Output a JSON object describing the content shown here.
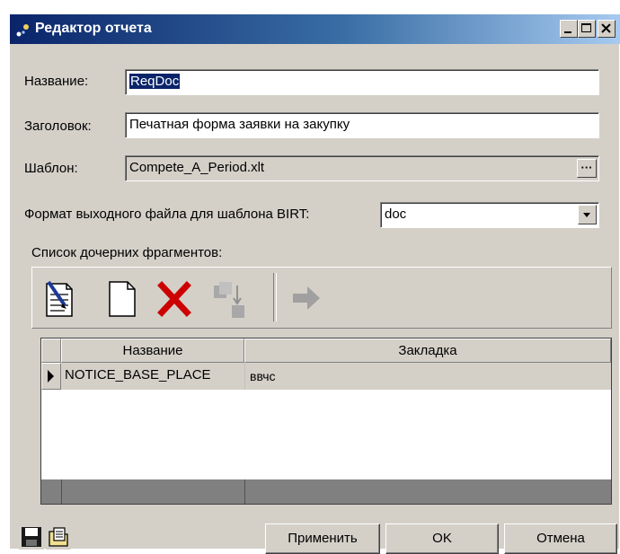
{
  "window": {
    "title": "Редактор отчета",
    "title_icon": "report-editor-icon"
  },
  "form": {
    "name_label": "Название:",
    "name_value": "ReqDoc",
    "heading_label": "Заголовок:",
    "heading_value": "Печатная форма заявки на закупку",
    "template_label": "Шаблон:",
    "template_value": "Compete_A_Period.xlt",
    "browse_label": "···",
    "format_label": "Формат выходного файла для шаблона BIRT:",
    "format_value": "doc"
  },
  "fragments": {
    "section_label": "Список дочерних фрагментов:",
    "toolbar_icons": [
      "edit-document-icon",
      "new-document-icon",
      "delete-icon",
      "move-down-icon",
      "arrow-right-icon"
    ],
    "columns": [
      "Название",
      "Закладка"
    ],
    "rows": [
      {
        "name": "NOTICE_BASE_PLACE",
        "bookmark": "ввчс"
      }
    ]
  },
  "footer": {
    "icons": [
      "save-icon",
      "open-file-icon"
    ],
    "apply_label": "Применить",
    "ok_label": "OK",
    "cancel_label": "Отмена"
  },
  "colors": {
    "title_start": "#0a246a",
    "title_end": "#a6caf0",
    "face": "#d4d0c8",
    "delete_red": "#cc0000"
  }
}
